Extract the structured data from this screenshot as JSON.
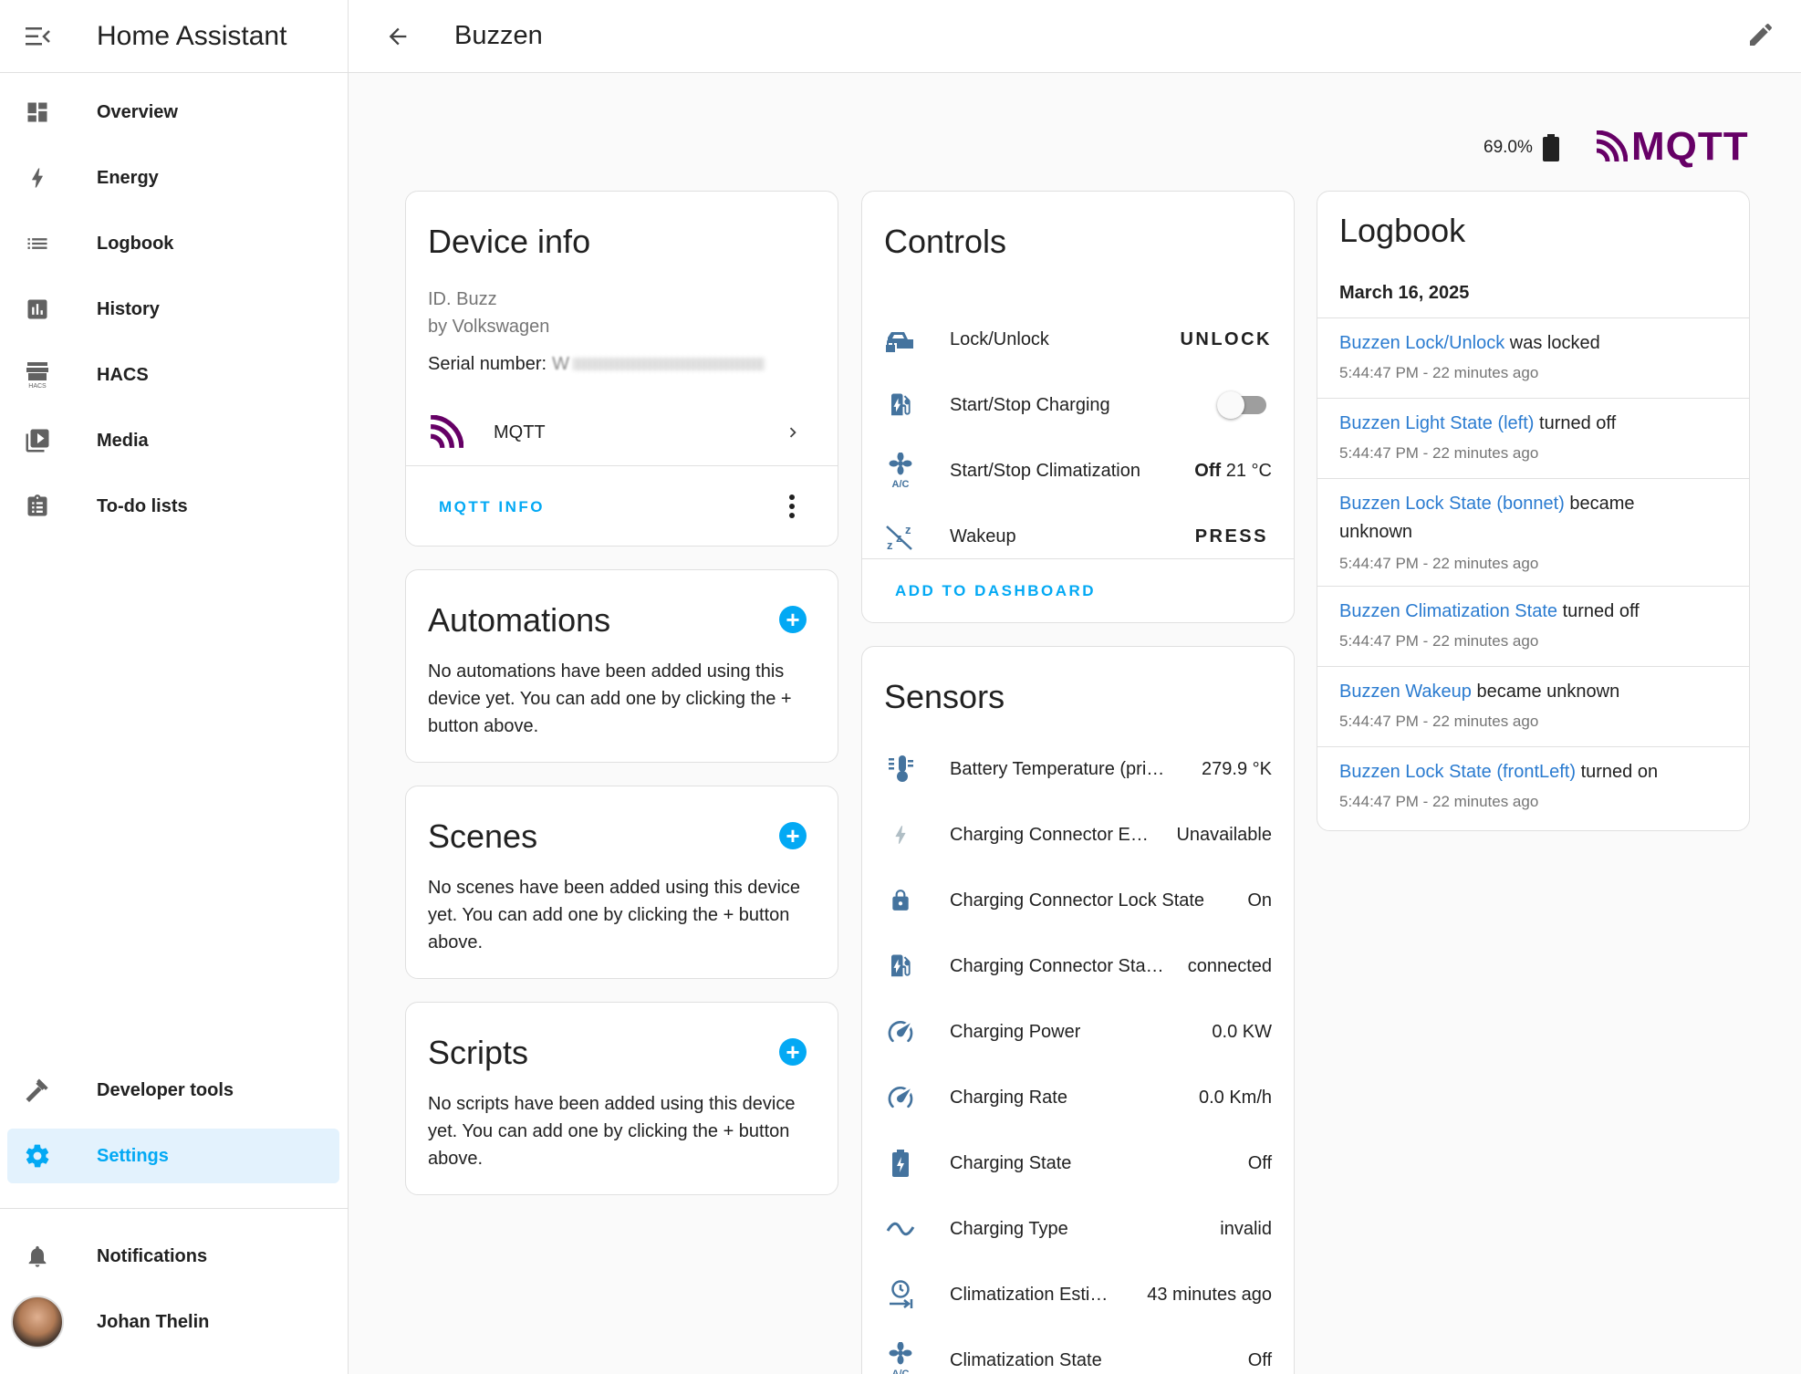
{
  "app": {
    "title": "Home Assistant"
  },
  "sidebar": {
    "items": [
      {
        "label": "Overview",
        "icon": "dashboard-icon"
      },
      {
        "label": "Energy",
        "icon": "lightning-icon"
      },
      {
        "label": "Logbook",
        "icon": "list-icon"
      },
      {
        "label": "History",
        "icon": "chart-icon"
      },
      {
        "label": "HACS",
        "icon": "hacs-icon"
      },
      {
        "label": "Media",
        "icon": "media-icon"
      },
      {
        "label": "To-do lists",
        "icon": "clipboard-icon"
      }
    ],
    "developer_tools": "Developer tools",
    "settings": "Settings",
    "notifications": "Notifications",
    "user": "Johan Thelin"
  },
  "header": {
    "title": "Buzzen"
  },
  "status": {
    "battery": "69.0%",
    "integration_logo": "MQTT"
  },
  "device_info": {
    "title": "Device info",
    "model": "ID. Buzz",
    "manufacturer": "by Volkswagen",
    "serial_label": "Serial number:",
    "serial_value": "W",
    "integration": "MQTT",
    "info_button": "MQTT INFO"
  },
  "automations": {
    "title": "Automations",
    "text": "No automations have been added using this device yet. You can add one by clicking the + button above."
  },
  "scenes": {
    "title": "Scenes",
    "text": "No scenes have been added using this device yet. You can add one by clicking the + button above."
  },
  "scripts": {
    "title": "Scripts",
    "text": "No scripts have been added using this device yet. You can add one by clicking the + button above."
  },
  "controls": {
    "title": "Controls",
    "lock": {
      "name": "Lock/Unlock",
      "action": "UNLOCK"
    },
    "charging": {
      "name": "Start/Stop Charging"
    },
    "climate": {
      "name": "Start/Stop Climatization",
      "state": "Off",
      "temp": "21 °C"
    },
    "wakeup": {
      "name": "Wakeup",
      "action": "PRESS"
    },
    "add_to_dashboard": "ADD TO DASHBOARD"
  },
  "sensors": {
    "title": "Sensors",
    "items": [
      {
        "name": "Battery Temperature (pri…",
        "value": "279.9 °K"
      },
      {
        "name": "Charging Connector E…",
        "value": "Unavailable"
      },
      {
        "name": "Charging Connector Lock State",
        "value": "On"
      },
      {
        "name": "Charging Connector Sta…",
        "value": "connected"
      },
      {
        "name": "Charging Power",
        "value": "0.0 KW"
      },
      {
        "name": "Charging Rate",
        "value": "0.0 Km/h"
      },
      {
        "name": "Charging State",
        "value": "Off"
      },
      {
        "name": "Charging Type",
        "value": "invalid"
      },
      {
        "name": "Climatization Esti…",
        "value": "43 minutes ago"
      },
      {
        "name": "Climatization State",
        "value": "Off"
      }
    ]
  },
  "logbook": {
    "title": "Logbook",
    "date": "March 16, 2025",
    "entries": [
      {
        "entity": "Buzzen Lock/Unlock",
        "message": " was locked",
        "time": "5:44:47 PM - 22 minutes ago"
      },
      {
        "entity": "Buzzen Light State (left)",
        "message": " turned off",
        "time": "5:44:47 PM - 22 minutes ago"
      },
      {
        "entity": "Buzzen Lock State (bonnet)",
        "message": " became unknown",
        "time": "5:44:47 PM - 22 minutes ago"
      },
      {
        "entity": "Buzzen Climatization State",
        "message": " turned off",
        "time": "5:44:47 PM - 22 minutes ago"
      },
      {
        "entity": "Buzzen Wakeup",
        "message": " became unknown",
        "time": "5:44:47 PM - 22 minutes ago"
      },
      {
        "entity": "Buzzen Lock State (frontLeft)",
        "message": " turned on",
        "time": "5:44:47 PM - 22 minutes ago"
      }
    ]
  },
  "colors": {
    "accent": "#03a9f4",
    "icon": "#44739e",
    "mqtt": "#660066",
    "link": "#2a7bd0"
  }
}
